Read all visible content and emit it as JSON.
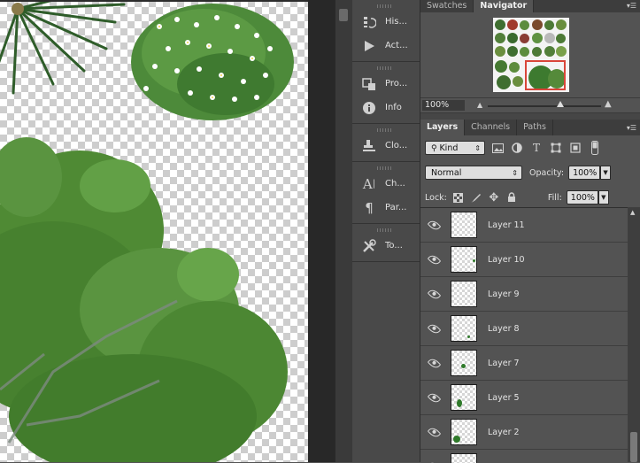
{
  "dock": {
    "groups": [
      {
        "items": [
          {
            "name": "history",
            "label": "His...",
            "icon": "history-icon"
          },
          {
            "name": "actions",
            "label": "Act...",
            "icon": "play-icon"
          }
        ]
      },
      {
        "items": [
          {
            "name": "properties",
            "label": "Pro...",
            "icon": "properties-icon"
          },
          {
            "name": "info",
            "label": "Info",
            "icon": "info-icon"
          }
        ]
      },
      {
        "items": [
          {
            "name": "clone-source",
            "label": "Clo...",
            "icon": "clone-source-icon"
          }
        ]
      },
      {
        "items": [
          {
            "name": "character",
            "label": "Ch...",
            "icon": "character-icon"
          },
          {
            "name": "paragraph",
            "label": "Par...",
            "icon": "paragraph-icon"
          }
        ]
      },
      {
        "items": [
          {
            "name": "tool-presets",
            "label": "To...",
            "icon": "tool-presets-icon"
          }
        ]
      }
    ]
  },
  "navigator_panel": {
    "tabs": [
      "Swatches",
      "Navigator"
    ],
    "active_tab": "Navigator",
    "zoom": "100%",
    "zoom_slider_position": 0.64
  },
  "layers_panel": {
    "tabs": [
      "Layers",
      "Channels",
      "Paths"
    ],
    "active_tab": "Layers",
    "filter_kind": "Kind",
    "blend_mode": "Normal",
    "opacity_label": "Opacity:",
    "opacity": "100%",
    "lock_label": "Lock:",
    "fill_label": "Fill:",
    "fill": "100%",
    "layers": [
      {
        "name": "Layer 11",
        "visible": true
      },
      {
        "name": "Layer 10",
        "visible": true
      },
      {
        "name": "Layer 9",
        "visible": true
      },
      {
        "name": "Layer 8",
        "visible": true
      },
      {
        "name": "Layer 7",
        "visible": true
      },
      {
        "name": "Layer 5",
        "visible": true
      },
      {
        "name": "Layer 2",
        "visible": true
      },
      {
        "name": "",
        "visible": true
      }
    ]
  },
  "colors": {
    "panel_bg": "#535353",
    "dock_bg": "#494949",
    "tab_bar": "#3d3d3d",
    "navigator_proxy": "#d9463a",
    "foliage": "#3f7a2c"
  }
}
